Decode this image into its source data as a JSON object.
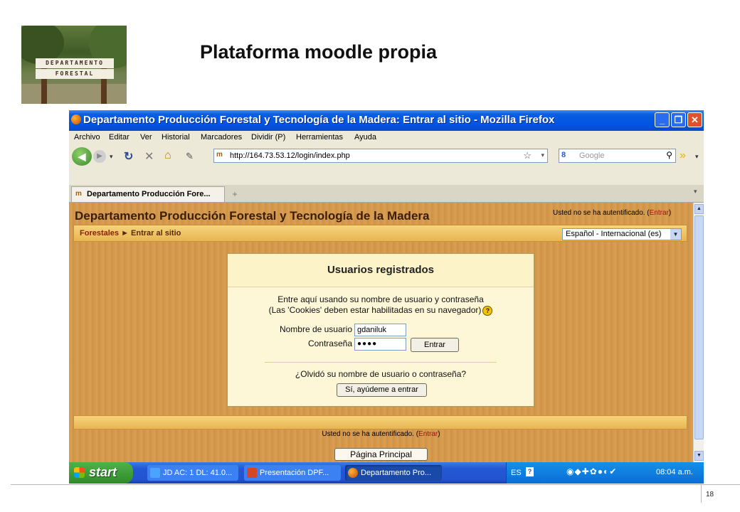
{
  "slide": {
    "title": "Plataforma moodle propia",
    "logo_sign_top": "DEPARTAMENTO",
    "logo_sign_bottom": "FORESTAL",
    "page_number": "18"
  },
  "window": {
    "title": "Departamento Producción Forestal y Tecnología de la Madera: Entrar al sitio - Mozilla Firefox",
    "controls": {
      "minimize": "_",
      "restore": "❐",
      "close": "✕"
    }
  },
  "menu": [
    "Archivo",
    "Editar",
    "Ver",
    "Historial",
    "Marcadores",
    "Dividir (P)",
    "Herramientas",
    "Ayuda"
  ],
  "toolbar": {
    "site_icon": "m",
    "url": "http://164.73.53.12/login/index.php",
    "search_engine": "8",
    "search_placeholder": "Google"
  },
  "tab": {
    "label": "Departamento Producción Fore...",
    "new_tab": "+"
  },
  "page": {
    "site_title": "Departamento Producción Forestal y Tecnología de la Madera",
    "login_status_prefix": "Usted no se ha autentificado. (",
    "login_link": "Entrar",
    "login_status_suffix": ")",
    "breadcrumb_home": "Forestales",
    "breadcrumb_sep": "►",
    "breadcrumb_current": "Entrar al sitio",
    "language": "Español - Internacional (es)",
    "login_box": {
      "heading": "Usuarios registrados",
      "intro_line1": "Entre aquí usando su nombre de usuario y contraseña",
      "intro_line2": "(Las 'Cookies' deben estar habilitadas en su navegador)",
      "username_label": "Nombre de usuario",
      "username_value": "gdaniluk",
      "password_label": "Contraseña",
      "password_value": "●●●●",
      "submit_label": "Entrar",
      "forgot_text": "¿Olvidó su nombre de usuario o contraseña?",
      "help_button": "Sí, ayúdeme a entrar"
    },
    "footer_login_prefix": "Usted no se ha autentificado. (",
    "footer_login_link": "Entrar",
    "footer_login_suffix": ")",
    "home_button": "Página Principal"
  },
  "taskbar": {
    "start_label": "start",
    "tasks": [
      "JD AC: 1 DL: 41.0...",
      "Presentación DPF...",
      "Departamento Pro..."
    ],
    "language": "ES",
    "clock": "08:04 a.m."
  },
  "colors": {
    "titlebar": "#0054e3",
    "page_wood": "#d3974c",
    "nav_strip": "#f6d37b",
    "login_box": "#fdf7d8",
    "link_red": "#a01010",
    "start_green": "#2f8a2a"
  }
}
